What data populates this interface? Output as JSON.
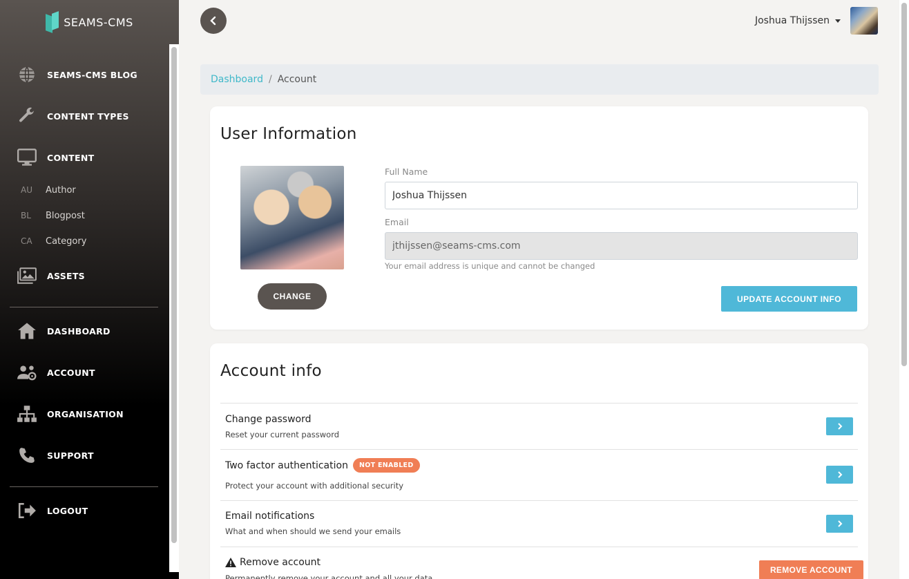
{
  "brand": {
    "name": "SEAMS-CMS"
  },
  "sidebar": {
    "items": [
      {
        "label": "SEAMS-CMS BLOG",
        "icon": "globe-icon"
      },
      {
        "label": "CONTENT TYPES",
        "icon": "wrench-icon"
      },
      {
        "label": "CONTENT",
        "icon": "monitor-icon"
      }
    ],
    "content_sub": [
      {
        "abbr": "AU",
        "label": "Author"
      },
      {
        "abbr": "BL",
        "label": "Blogpost"
      },
      {
        "abbr": "CA",
        "label": "Category"
      }
    ],
    "assets": {
      "label": "ASSETS",
      "icon": "images-icon"
    },
    "main": [
      {
        "label": "DASHBOARD",
        "icon": "home-icon"
      },
      {
        "label": "ACCOUNT",
        "icon": "users-cog-icon"
      },
      {
        "label": "ORGANISATION",
        "icon": "sitemap-icon"
      },
      {
        "label": "SUPPORT",
        "icon": "phone-icon"
      }
    ],
    "logout": {
      "label": "LOGOUT",
      "icon": "sign-out-icon"
    }
  },
  "header": {
    "user_name": "Joshua Thijssen"
  },
  "breadcrumb": {
    "link": "Dashboard",
    "separator": "/",
    "current": "Account"
  },
  "user_info": {
    "title": "User Information",
    "change_label": "CHANGE",
    "full_name_label": "Full Name",
    "full_name_value": "Joshua Thijssen",
    "email_label": "Email",
    "email_value": "jthijssen@seams-cms.com",
    "email_help": "Your email address is unique and cannot be changed",
    "update_label": "UPDATE ACCOUNT INFO"
  },
  "account_info": {
    "title": "Account info",
    "rows": [
      {
        "title": "Change password",
        "desc": "Reset your current password"
      },
      {
        "title": "Two factor authentication",
        "badge": "NOT ENABLED",
        "desc": "Protect your account with additional security"
      },
      {
        "title": "Email notifications",
        "desc": "What and when should we send your emails"
      },
      {
        "title": "Remove account",
        "desc": "Permanently remove your account and all your data",
        "button": "REMOVE ACCOUNT"
      }
    ]
  },
  "colors": {
    "accent": "#4fb8d8",
    "danger": "#f07e55",
    "link": "#3fb8c9",
    "dark": "#5a5450"
  }
}
